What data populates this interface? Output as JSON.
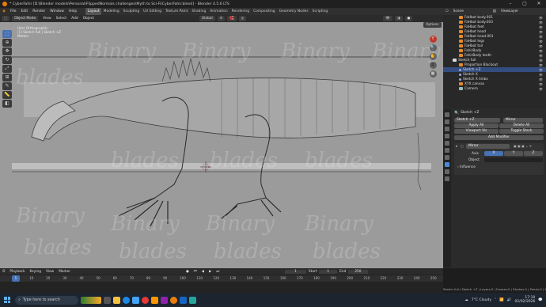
{
  "window": {
    "title": "* CyberFahir [D:\\Blender models\\Personal\\FlippedNormals challenges\\Myth to Sci-Fi\\CyberFahir.blend] - Blender 4.5.6 LTS"
  },
  "menubar": {
    "menus": [
      "File",
      "Edit",
      "Render",
      "Window",
      "Help"
    ],
    "workspaces": [
      "Layout",
      "Modeling",
      "Sculpting",
      "UV Editing",
      "Texture Paint",
      "Shading",
      "Animation",
      "Rendering",
      "Compositing",
      "Geometry Nodes",
      "Scripting"
    ],
    "active_workspace": "Layout"
  },
  "scene": {
    "scene_label": "Scene",
    "view_layer": "ViewLayer"
  },
  "viewport_header": {
    "mode": "Object Mode",
    "menus": [
      "View",
      "Select",
      "Add",
      "Object"
    ],
    "orientation": "Global",
    "options": "Options"
  },
  "viewport_overlay": {
    "line1": "User Orthographic",
    "line2": "(1) Sketch full | Sketch +Z",
    "line3": "Meters"
  },
  "watermark": {
    "word1": "Binary",
    "word2": "blades"
  },
  "outliner": {
    "items": [
      {
        "label": "FaHbot body.001",
        "kind": "obj"
      },
      {
        "label": "FaHbot body.003",
        "kind": "obj"
      },
      {
        "label": "FaHbot feet",
        "kind": "obj"
      },
      {
        "label": "FaHbot head",
        "kind": "obj"
      },
      {
        "label": "FaHbot head.001",
        "kind": "obj"
      },
      {
        "label": "FaHbot legs",
        "kind": "obj"
      },
      {
        "label": "FaHbot tail",
        "kind": "obj"
      },
      {
        "label": "FahirBody",
        "kind": "obj"
      },
      {
        "label": "FahirBody teeth",
        "kind": "obj"
      },
      {
        "label": "Sketch full",
        "kind": "col"
      },
      {
        "label": "Proportion Blockout",
        "kind": "obj"
      },
      {
        "label": "Sketch +Z",
        "kind": "obj"
      },
      {
        "label": "Sketch X",
        "kind": "obj"
      },
      {
        "label": "Sketch X limbs",
        "kind": "obj"
      },
      {
        "label": "XYX canvas",
        "kind": "obj"
      },
      {
        "label": "Camera",
        "kind": "obj"
      }
    ]
  },
  "properties": {
    "object_name": "Sketch +Z",
    "modifier_dropdown": "Mirror",
    "apply_all": "Apply All",
    "delete_all": "Delete All",
    "viewport_vis": "Viewport Vis",
    "toggle_stack": "Toggle Stack",
    "add_modifier": "Add Modifier",
    "modifier_name": "Mirror",
    "axis_label": "Axis",
    "axes": [
      "X",
      "Y",
      "Z"
    ],
    "active_axis": "X",
    "object_label": "Object",
    "object_placeholder": "",
    "influence": "Influence"
  },
  "timeline": {
    "menus": [
      "Playback",
      "Keying",
      "View",
      "Marker"
    ],
    "current_frame": "1",
    "start_frame": "1",
    "start_label": "Start",
    "end_label": "End",
    "end_frame": "250",
    "ticks": [
      "10",
      "20",
      "30",
      "40",
      "50",
      "60",
      "70",
      "80",
      "90",
      "100",
      "110",
      "120",
      "130",
      "140",
      "150",
      "160",
      "170",
      "180",
      "190",
      "200",
      "210",
      "220",
      "230",
      "240",
      "250"
    ]
  },
  "statusbar": {
    "text": "Sketch full | Sketch +Z | Layers:0 | Frames:0 | Strokes:0 | Points:0 | 4.5.6"
  },
  "taskbar": {
    "search_placeholder": "Type here to search",
    "weather": "7°C  Cloudy",
    "time": "17:10",
    "date": "02/02/2026"
  },
  "colors": {
    "accent": "#4772b3",
    "blender_orange": "#e87d0d",
    "viewport_bg": "#9b9b9b"
  }
}
